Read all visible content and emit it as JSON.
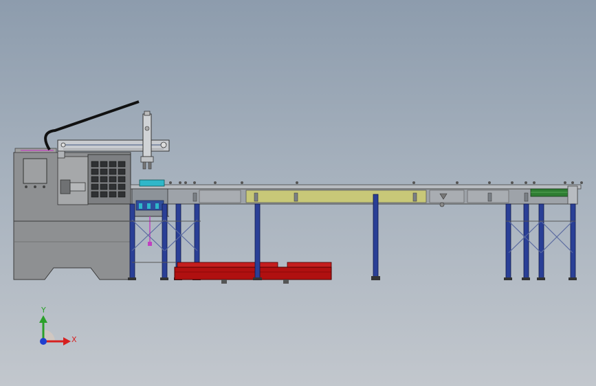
{
  "triad": {
    "y_label": "Y",
    "x_label": "X",
    "y_color": "#2aa02a",
    "x_color": "#d62020",
    "z_color": "#1f3fd0"
  },
  "colors": {
    "frame_blue": "#1f2f8a",
    "leg_blue_light": "#3450b0",
    "tray_red": "#b01010",
    "panel_olive": "#c8c878",
    "steel": "#8a8f95",
    "lathe_gray": "#8e9092",
    "green_guard": "#2e7d32",
    "cyan_block": "#2fb7c9",
    "magenta_bits": "#c040c0"
  }
}
